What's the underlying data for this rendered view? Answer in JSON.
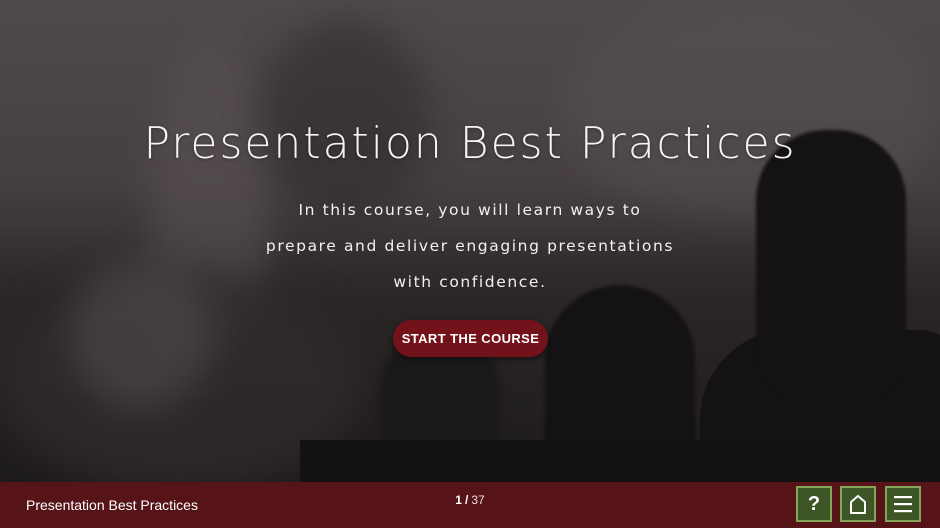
{
  "hero": {
    "title": "Presentation Best Practices",
    "subtitle_lines": [
      "In this course, you will learn ways to",
      "prepare and deliver engaging presentations",
      "with confidence."
    ],
    "start_button_label": "START THE COURSE"
  },
  "footer": {
    "course_title": "Presentation Best Practices",
    "current_page": "1",
    "separator": "/",
    "total_pages": "37",
    "help_label": "?",
    "help_icon": "question-mark-icon",
    "home_icon": "home-icon",
    "menu_icon": "hamburger-menu-icon"
  },
  "colors": {
    "footer_bg": "#561419",
    "start_button_bg": "#74121b",
    "nav_button_bg": "#3e5526",
    "nav_button_border": "#84a55a"
  }
}
